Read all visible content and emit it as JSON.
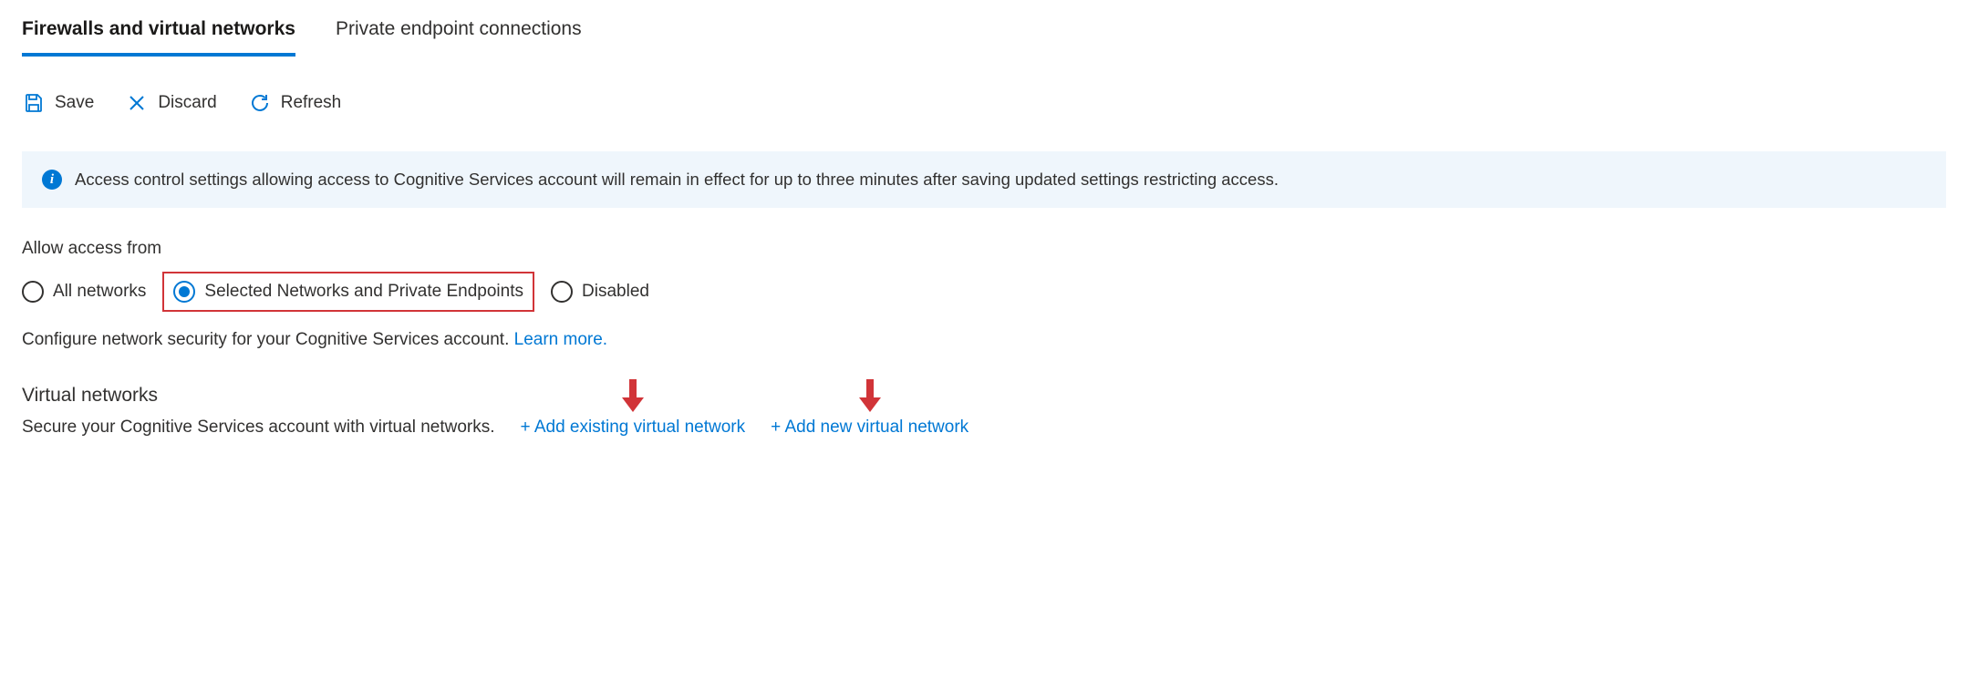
{
  "tabs": {
    "firewalls": "Firewalls and virtual networks",
    "privateEndpoints": "Private endpoint connections"
  },
  "toolbar": {
    "save": "Save",
    "discard": "Discard",
    "refresh": "Refresh"
  },
  "infoBanner": {
    "text": "Access control settings allowing access to Cognitive Services account will remain in effect for up to three minutes after saving updated settings restricting access."
  },
  "allowAccess": {
    "label": "Allow access from",
    "options": {
      "all": "All networks",
      "selected": "Selected Networks and Private Endpoints",
      "disabled": "Disabled"
    }
  },
  "configDescription": {
    "text": "Configure network security for your Cognitive Services account. ",
    "learnMore": "Learn more."
  },
  "virtualNetworks": {
    "heading": "Virtual networks",
    "description": "Secure your Cognitive Services account with virtual networks.",
    "addExisting": "+ Add existing virtual network",
    "addNew": "+ Add new virtual network"
  }
}
